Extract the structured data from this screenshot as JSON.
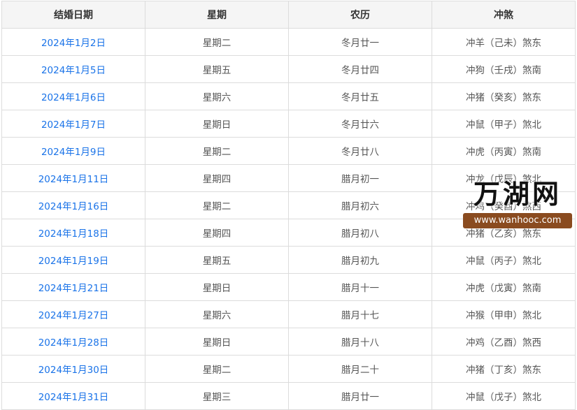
{
  "table": {
    "headers": [
      "结婚日期",
      "星期",
      "农历",
      "冲煞"
    ],
    "rows": [
      {
        "date": "2024年1月2日",
        "weekday": "星期二",
        "lunar": "冬月廿一",
        "clash": "冲羊（己未）煞东"
      },
      {
        "date": "2024年1月5日",
        "weekday": "星期五",
        "lunar": "冬月廿四",
        "clash": "冲狗（壬戌）煞南"
      },
      {
        "date": "2024年1月6日",
        "weekday": "星期六",
        "lunar": "冬月廿五",
        "clash": "冲猪（癸亥）煞东"
      },
      {
        "date": "2024年1月7日",
        "weekday": "星期日",
        "lunar": "冬月廿六",
        "clash": "冲鼠（甲子）煞北"
      },
      {
        "date": "2024年1月9日",
        "weekday": "星期二",
        "lunar": "冬月廿八",
        "clash": "冲虎（丙寅）煞南"
      },
      {
        "date": "2024年1月11日",
        "weekday": "星期四",
        "lunar": "腊月初一",
        "clash": "冲龙（戊辰）煞北"
      },
      {
        "date": "2024年1月16日",
        "weekday": "星期二",
        "lunar": "腊月初六",
        "clash": "冲鸡（癸酉）煞西"
      },
      {
        "date": "2024年1月18日",
        "weekday": "星期四",
        "lunar": "腊月初八",
        "clash": "冲猪（乙亥）煞东"
      },
      {
        "date": "2024年1月19日",
        "weekday": "星期五",
        "lunar": "腊月初九",
        "clash": "冲鼠（丙子）煞北"
      },
      {
        "date": "2024年1月21日",
        "weekday": "星期日",
        "lunar": "腊月十一",
        "clash": "冲虎（戊寅）煞南"
      },
      {
        "date": "2024年1月27日",
        "weekday": "星期六",
        "lunar": "腊月十七",
        "clash": "冲猴（甲申）煞北"
      },
      {
        "date": "2024年1月28日",
        "weekday": "星期日",
        "lunar": "腊月十八",
        "clash": "冲鸡（乙酉）煞西"
      },
      {
        "date": "2024年1月30日",
        "weekday": "星期二",
        "lunar": "腊月二十",
        "clash": "冲猪（丁亥）煞东"
      },
      {
        "date": "2024年1月31日",
        "weekday": "星期三",
        "lunar": "腊月廿一",
        "clash": "冲鼠（戊子）煞北"
      }
    ]
  },
  "watermark": {
    "title": "万湖网",
    "url": "www.wanhooc.com"
  },
  "colors": {
    "link": "#1a73e8",
    "header_bg": "#f5f5f5",
    "border": "#dcdcdc",
    "watermark_bg": "#8a4b1f"
  }
}
